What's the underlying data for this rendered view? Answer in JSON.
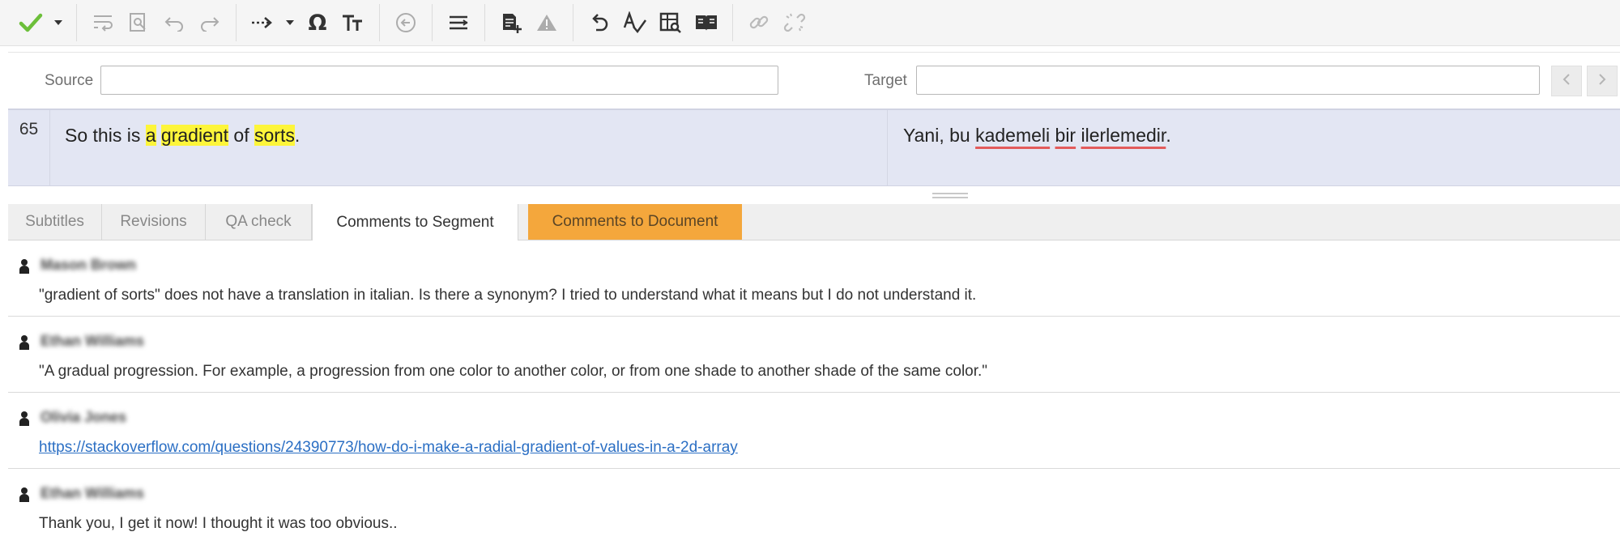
{
  "toolbar": {
    "icons": [
      "confirm-check-icon",
      "dropdown-arrow-icon",
      "wrap-text-icon",
      "find-image-icon",
      "undo-icon",
      "redo-icon",
      "arrow-right-icon",
      "dropdown-arrow-icon",
      "omega-symbol-icon",
      "text-size-icon",
      "circle-arrow-icon",
      "align-icon",
      "add-document-icon",
      "warning-triangle-icon",
      "undo-alt-icon",
      "spellcheck-icon",
      "search-table-icon",
      "book-icon",
      "link-icon",
      "unlink-icon"
    ]
  },
  "search": {
    "source_label": "Source",
    "source_value": "",
    "target_label": "Target",
    "target_value": ""
  },
  "segment": {
    "number": "65",
    "source": [
      {
        "text": "So this is ",
        "hl": false
      },
      {
        "text": "a",
        "hl": true
      },
      {
        "text": " ",
        "hl": false
      },
      {
        "text": "gradient",
        "hl": true
      },
      {
        "text": " of ",
        "hl": false
      },
      {
        "text": "sorts",
        "hl": true
      },
      {
        "text": ".",
        "hl": false
      }
    ],
    "target": [
      {
        "text": "Yani, bu ",
        "sp": false
      },
      {
        "text": "kademeli",
        "sp": true
      },
      {
        "text": " ",
        "sp": false
      },
      {
        "text": "bir",
        "sp": true
      },
      {
        "text": " ",
        "sp": false
      },
      {
        "text": "ilerlemedir",
        "sp": true
      },
      {
        "text": ".",
        "sp": false
      }
    ]
  },
  "tabs": [
    {
      "label": "Subtitles"
    },
    {
      "label": "Revisions"
    },
    {
      "label": "QA check"
    },
    {
      "label": "Comments to Segment"
    },
    {
      "label": "Comments to Document"
    }
  ],
  "comments": [
    {
      "author": "Mason Brown",
      "text": "\"gradient of sorts\" does not have a translation in italian. Is there a synonym? I tried to understand what it means but I do not understand it.",
      "is_link": false
    },
    {
      "author": "Ethan Williams",
      "text": "\"A gradual progression. For example, a progression from one color to another color, or from one shade to another shade of the same color.\"",
      "is_link": false
    },
    {
      "author": "Olivia Jones",
      "text": "https://stackoverflow.com/questions/24390773/how-do-i-make-a-radial-gradient-of-values-in-a-2d-array",
      "is_link": true
    },
    {
      "author": "Ethan Williams",
      "text": "Thank you, I get it now! I thought it was too obvious..",
      "is_link": false
    }
  ],
  "colors": {
    "accent_check": "#6cbf3a",
    "active_doc_tab": "#f4a73c",
    "highlight": "#fdf53a",
    "segment_bg": "#e3e6f3",
    "spell_underline": "#e35b5b",
    "link": "#2b6fc4"
  }
}
